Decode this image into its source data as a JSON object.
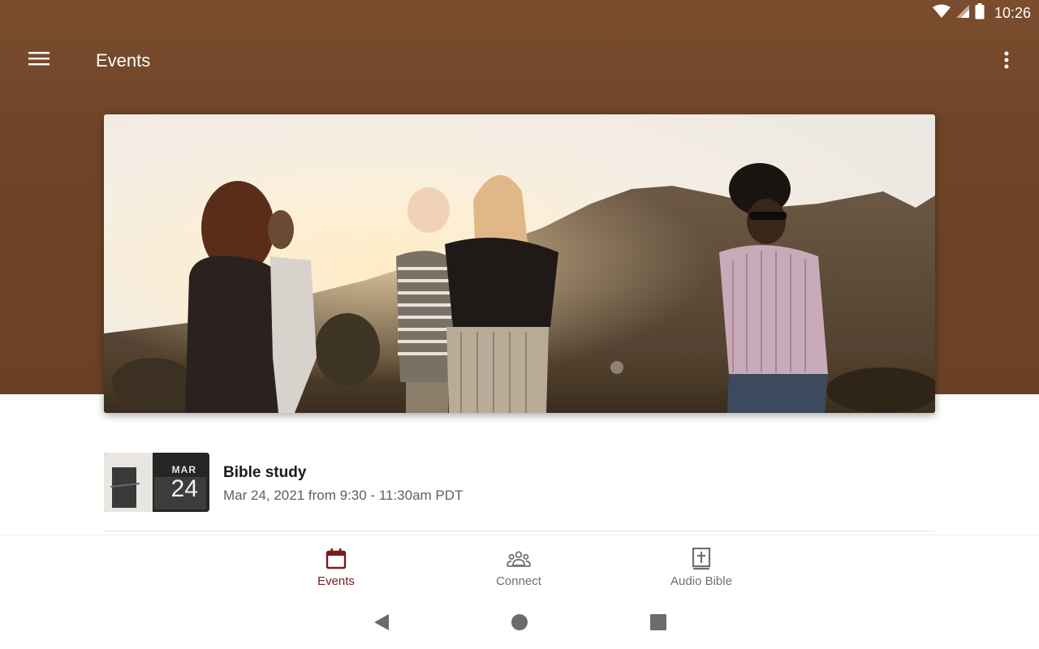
{
  "status_bar": {
    "time": "10:26",
    "icons": [
      "wifi-icon",
      "cell-signal-icon",
      "battery-icon"
    ]
  },
  "app_bar": {
    "title": "Events",
    "menu_icon": "hamburger-menu-icon",
    "overflow_icon": "more-vert-icon"
  },
  "events": [
    {
      "thumb_month": "MAR",
      "thumb_day": "24",
      "title": "Bible study",
      "date": "Mar 24, 2021 from 9:30 - 11:30am PDT"
    }
  ],
  "bottom_nav": {
    "items": [
      {
        "label": "Events",
        "icon": "calendar-icon",
        "active": true
      },
      {
        "label": "Connect",
        "icon": "people-icon",
        "active": false
      },
      {
        "label": "Audio Bible",
        "icon": "bible-icon",
        "active": false
      }
    ]
  },
  "system_nav": [
    "back-icon",
    "home-icon",
    "recents-icon"
  ],
  "colors": {
    "header_brown": "#6e4427",
    "active_nav": "#7a1a1f",
    "inactive_nav": "#6f6f6f"
  }
}
